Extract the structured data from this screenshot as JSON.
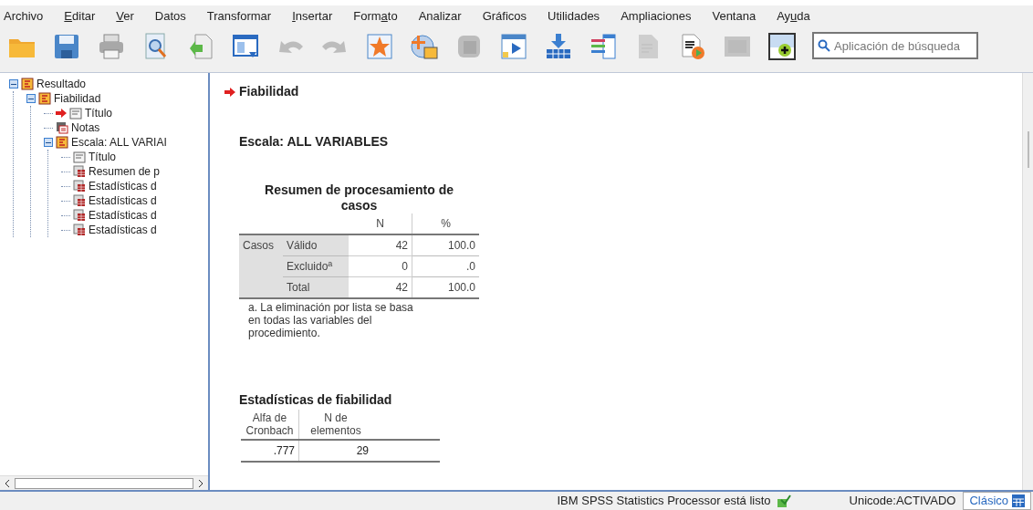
{
  "menu": [
    {
      "parts": [
        {
          "text": "Archivo",
          "underlined": false
        }
      ]
    },
    {
      "parts": [
        {
          "text": "E",
          "underlined": true
        },
        {
          "text": "ditar",
          "underlined": false
        }
      ]
    },
    {
      "parts": [
        {
          "text": "V",
          "underlined": true
        },
        {
          "text": "er",
          "underlined": false
        }
      ]
    },
    {
      "parts": [
        {
          "text": "Datos",
          "underlined": false
        }
      ]
    },
    {
      "parts": [
        {
          "text": "Transformar",
          "underlined": false
        }
      ]
    },
    {
      "parts": [
        {
          "text": "I",
          "underlined": true
        },
        {
          "text": "nsertar",
          "underlined": false
        }
      ]
    },
    {
      "parts": [
        {
          "text": "Form",
          "underlined": false
        },
        {
          "text": "a",
          "underlined": true
        },
        {
          "text": "to",
          "underlined": false
        }
      ]
    },
    {
      "parts": [
        {
          "text": "Analizar",
          "underlined": false
        }
      ]
    },
    {
      "parts": [
        {
          "text": "Gráficos",
          "underlined": false
        }
      ]
    },
    {
      "parts": [
        {
          "text": "Utilidades",
          "underlined": false
        }
      ]
    },
    {
      "parts": [
        {
          "text": "Ampliaciones",
          "underlined": false
        }
      ]
    },
    {
      "parts": [
        {
          "text": "Ventana",
          "underlined": false
        }
      ]
    },
    {
      "parts": [
        {
          "text": "Ay",
          "underlined": false
        },
        {
          "text": "u",
          "underlined": true
        },
        {
          "text": "da",
          "underlined": false
        }
      ]
    }
  ],
  "toolbar": [
    {
      "kind": "open",
      "disabled": false
    },
    {
      "kind": "save",
      "disabled": false
    },
    {
      "kind": "print",
      "disabled": false
    },
    {
      "kind": "preview",
      "disabled": false
    },
    {
      "kind": "export",
      "disabled": false
    },
    {
      "kind": "window",
      "disabled": false
    },
    {
      "kind": "undo",
      "disabled": true
    },
    {
      "kind": "redo",
      "disabled": true
    },
    {
      "kind": "star",
      "disabled": false
    },
    {
      "kind": "globe",
      "disabled": false
    },
    {
      "kind": "tile",
      "disabled": true
    },
    {
      "kind": "table",
      "disabled": false
    },
    {
      "kind": "download",
      "disabled": false
    },
    {
      "kind": "list",
      "disabled": false
    },
    {
      "kind": "doc",
      "disabled": true
    },
    {
      "kind": "docplay",
      "disabled": false
    },
    {
      "kind": "square",
      "disabled": true
    },
    {
      "kind": "plus",
      "disabled": false
    }
  ],
  "search": {
    "placeholder": "Aplicación de búsqueda"
  },
  "tree": [
    {
      "kind": "book",
      "label": "Resultado",
      "expanded": true,
      "current": false,
      "children": [
        {
          "kind": "book",
          "label": "Fiabilidad",
          "expanded": true,
          "current": false,
          "children": [
            {
              "kind": "title",
              "label": "Título",
              "current": true
            },
            {
              "kind": "notes",
              "label": "Notas",
              "current": false
            },
            {
              "kind": "book",
              "label": "Escala: ALL VARIAI",
              "expanded": true,
              "current": false,
              "children": [
                {
                  "kind": "title",
                  "label": "Título",
                  "current": false
                },
                {
                  "kind": "table",
                  "label": "Resumen de p",
                  "current": false
                },
                {
                  "kind": "table",
                  "label": "Estadísticas d",
                  "current": false
                },
                {
                  "kind": "table",
                  "label": "Estadísticas d",
                  "current": false
                },
                {
                  "kind": "table",
                  "label": "Estadísticas d",
                  "current": false
                },
                {
                  "kind": "table",
                  "label": "Estadísticas d",
                  "current": false
                }
              ]
            }
          ]
        }
      ]
    }
  ],
  "output": {
    "heading": "Fiabilidad",
    "heading_current": true,
    "scale": "Escala: ALL VARIABLES",
    "case_summary": {
      "title": "Resumen de procesamiento de casos",
      "columns": [
        "N",
        "%"
      ],
      "group": "Casos",
      "rows": [
        {
          "label": "Válido",
          "n": "42",
          "pct": "100.0"
        },
        {
          "label": "Excluido$^{a}$",
          "n": "0",
          "pct": ".0"
        },
        {
          "label": "Total",
          "n": "42",
          "pct": "100.0"
        }
      ],
      "footnote": "a. La eliminación por lista se basa en todas las variables del procedimiento."
    },
    "reliability": {
      "title": "Estadísticas de fiabilidad",
      "columns": [
        "Alfa de Cronbach",
        "N de elementos"
      ],
      "values": [
        ".777",
        "29"
      ]
    }
  },
  "status_bar": {
    "message": "IBM SPSS Statistics Processor está listo",
    "encoding": "Unicode:ACTIVADO",
    "mode_button": "Clásico"
  }
}
